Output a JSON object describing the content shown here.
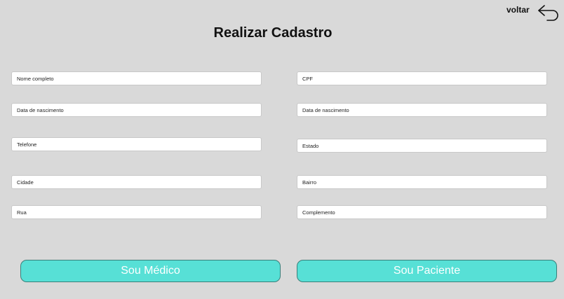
{
  "header": {
    "back_label": "voltar",
    "back_icon": "return-arrow-icon",
    "title": "Realizar Cadastro"
  },
  "form": {
    "left": [
      {
        "name": "nome-completo-field",
        "placeholder": "Nome completo"
      },
      {
        "name": "data-nascimento-left-field",
        "placeholder": "Data de nascimento"
      },
      {
        "name": "telefone-field",
        "placeholder": "Telefone"
      },
      {
        "name": "cidade-field",
        "placeholder": "Cidade"
      },
      {
        "name": "rua-field",
        "placeholder": "Rua"
      }
    ],
    "right": [
      {
        "name": "cpf-field",
        "placeholder": "CPF"
      },
      {
        "name": "data-nascimento-right-field",
        "placeholder": "Data de nascimento"
      },
      {
        "name": "estado-field",
        "placeholder": "Estado"
      },
      {
        "name": "bairro-field",
        "placeholder": "Bairro"
      },
      {
        "name": "complemento-field",
        "placeholder": "Complemento"
      }
    ]
  },
  "actions": {
    "medico_label": "Sou Médico",
    "paciente_label": "Sou Paciente"
  },
  "colors": {
    "background": "#d9d9d9",
    "button": "#57e0d6",
    "button_text": "#ffffff"
  }
}
